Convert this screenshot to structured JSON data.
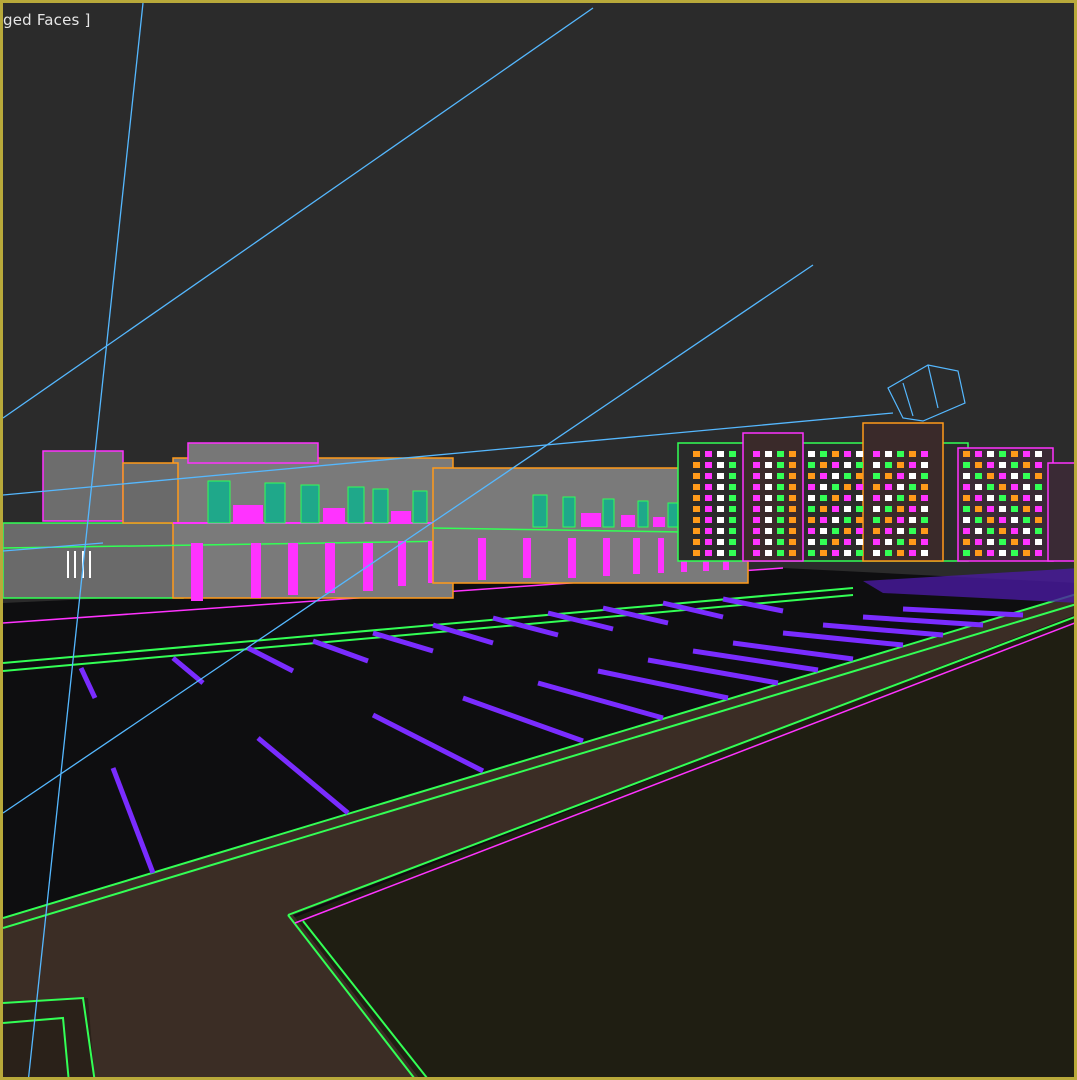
{
  "viewport": {
    "label": "ged Faces ]",
    "border_color": "#b8a93a",
    "background": "#2b2b2b"
  },
  "scene_colors": {
    "magenta": "#ff33ff",
    "green": "#33ff55",
    "orange": "#ff9a1a",
    "cyan": "#55b8ff",
    "purple": "#7a2cff",
    "grass": "#1f1e12",
    "sidewalk": "#3a2d24",
    "asphalt": "#0f0f10"
  }
}
